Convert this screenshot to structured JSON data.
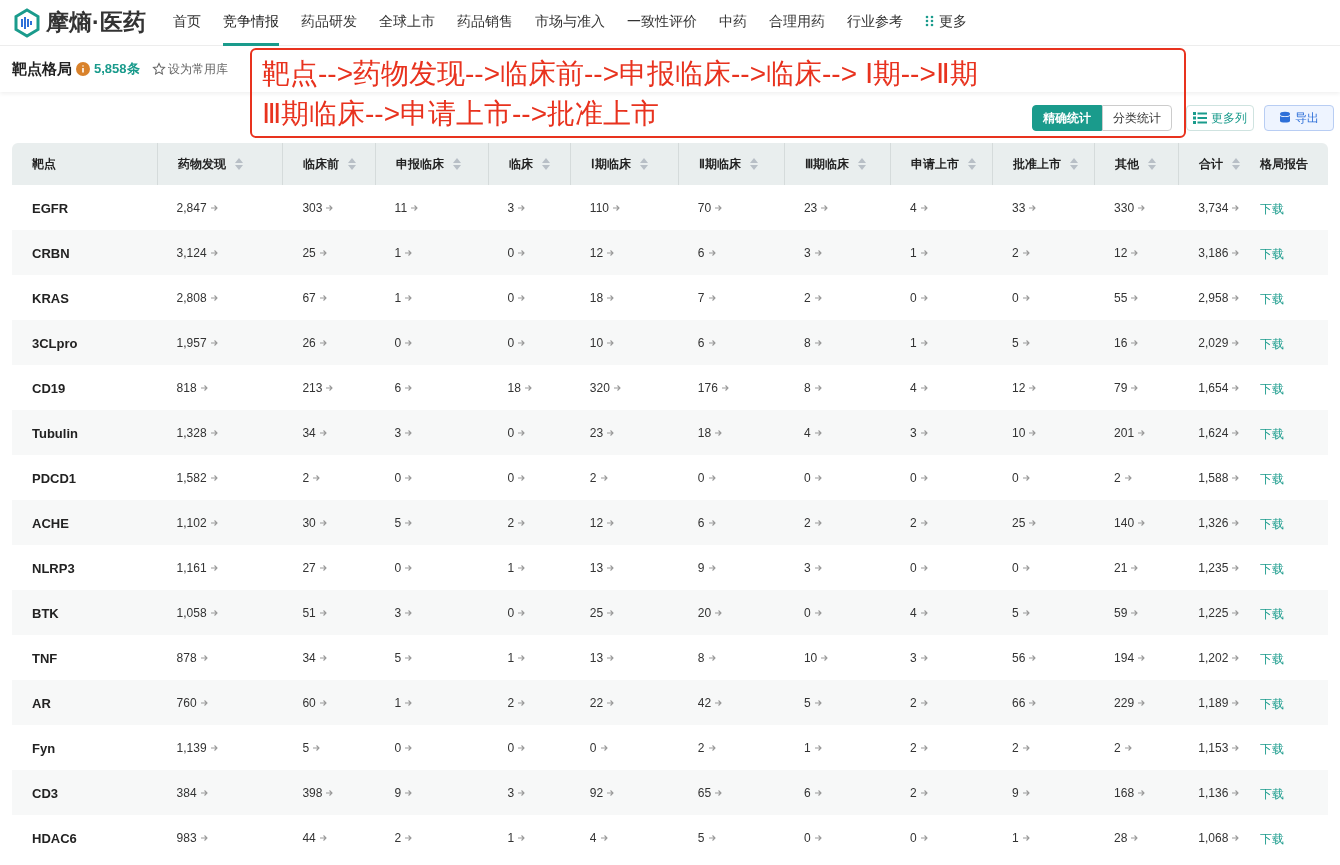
{
  "logo": {
    "text": "摩熵·医药"
  },
  "nav": [
    {
      "label": "首页",
      "selected": false
    },
    {
      "label": "竞争情报",
      "selected": true
    },
    {
      "label": "药品研发",
      "selected": false
    },
    {
      "label": "全球上市",
      "selected": false
    },
    {
      "label": "药品销售",
      "selected": false
    },
    {
      "label": "市场与准入",
      "selected": false
    },
    {
      "label": "一致性评价",
      "selected": false
    },
    {
      "label": "中药",
      "selected": false
    },
    {
      "label": "合理用药",
      "selected": false
    },
    {
      "label": "行业参考",
      "selected": false
    },
    {
      "label": "更多",
      "selected": false
    }
  ],
  "page": {
    "title": "靶点格局",
    "count": "5,858条",
    "favorite": "设为常用库"
  },
  "annotation": {
    "lines": [
      "靶点-->药物发现-->临床前-->申报临床-->临床--> Ⅰ期-->Ⅱ期",
      "Ⅲ期临床-->申请上市-->批准上市"
    ]
  },
  "toolbar": {
    "toggle": [
      {
        "label": "精确统计",
        "selected": true
      },
      {
        "label": "分类统计",
        "selected": false
      }
    ],
    "more_columns": "更多列",
    "export": "导出"
  },
  "table": {
    "columns": [
      {
        "label": "靶点",
        "sortable": false
      },
      {
        "label": "药物发现",
        "sortable": true
      },
      {
        "label": "临床前",
        "sortable": true
      },
      {
        "label": "申报临床",
        "sortable": true
      },
      {
        "label": "临床",
        "sortable": true
      },
      {
        "label": "Ⅰ期临床",
        "sortable": true
      },
      {
        "label": "Ⅱ期临床",
        "sortable": true
      },
      {
        "label": "Ⅲ期临床",
        "sortable": true
      },
      {
        "label": "申请上市",
        "sortable": true
      },
      {
        "label": "批准上市",
        "sortable": true
      },
      {
        "label": "其他",
        "sortable": true
      },
      {
        "label": "合计",
        "sortable": true
      },
      {
        "label": "格局报告",
        "sortable": false
      }
    ],
    "rows": [
      {
        "target": "EGFR",
        "values": [
          "2,847",
          "303",
          "11",
          "3",
          "110",
          "70",
          "23",
          "4",
          "33",
          "330",
          "3,734"
        ],
        "report": "下载"
      },
      {
        "target": "CRBN",
        "values": [
          "3,124",
          "25",
          "1",
          "0",
          "12",
          "6",
          "3",
          "1",
          "2",
          "12",
          "3,186"
        ],
        "report": "下载"
      },
      {
        "target": "KRAS",
        "values": [
          "2,808",
          "67",
          "1",
          "0",
          "18",
          "7",
          "2",
          "0",
          "0",
          "55",
          "2,958"
        ],
        "report": "下载"
      },
      {
        "target": "3CLpro",
        "values": [
          "1,957",
          "26",
          "0",
          "0",
          "10",
          "6",
          "8",
          "1",
          "5",
          "16",
          "2,029"
        ],
        "report": "下载"
      },
      {
        "target": "CD19",
        "values": [
          "818",
          "213",
          "6",
          "18",
          "320",
          "176",
          "8",
          "4",
          "12",
          "79",
          "1,654"
        ],
        "report": "下载"
      },
      {
        "target": "Tubulin",
        "values": [
          "1,328",
          "34",
          "3",
          "0",
          "23",
          "18",
          "4",
          "3",
          "10",
          "201",
          "1,624"
        ],
        "report": "下载"
      },
      {
        "target": "PDCD1",
        "values": [
          "1,582",
          "2",
          "0",
          "0",
          "2",
          "0",
          "0",
          "0",
          "0",
          "2",
          "1,588"
        ],
        "report": "下载"
      },
      {
        "target": "ACHE",
        "values": [
          "1,102",
          "30",
          "5",
          "2",
          "12",
          "6",
          "2",
          "2",
          "25",
          "140",
          "1,326"
        ],
        "report": "下载"
      },
      {
        "target": "NLRP3",
        "values": [
          "1,161",
          "27",
          "0",
          "1",
          "13",
          "9",
          "3",
          "0",
          "0",
          "21",
          "1,235"
        ],
        "report": "下载"
      },
      {
        "target": "BTK",
        "values": [
          "1,058",
          "51",
          "3",
          "0",
          "25",
          "20",
          "0",
          "4",
          "5",
          "59",
          "1,225"
        ],
        "report": "下载"
      },
      {
        "target": "TNF",
        "values": [
          "878",
          "34",
          "5",
          "1",
          "13",
          "8",
          "10",
          "3",
          "56",
          "194",
          "1,202"
        ],
        "report": "下载"
      },
      {
        "target": "AR",
        "values": [
          "760",
          "60",
          "1",
          "2",
          "22",
          "42",
          "5",
          "2",
          "66",
          "229",
          "1,189"
        ],
        "report": "下载"
      },
      {
        "target": "Fyn",
        "values": [
          "1,139",
          "5",
          "0",
          "0",
          "0",
          "2",
          "1",
          "2",
          "2",
          "2",
          "1,153"
        ],
        "report": "下载"
      },
      {
        "target": "CD3",
        "values": [
          "384",
          "398",
          "9",
          "3",
          "92",
          "65",
          "6",
          "2",
          "9",
          "168",
          "1,136"
        ],
        "report": "下载"
      },
      {
        "target": "HDAC6",
        "values": [
          "983",
          "44",
          "2",
          "1",
          "4",
          "5",
          "0",
          "0",
          "1",
          "28",
          "1,068"
        ],
        "report": "下载"
      }
    ]
  }
}
